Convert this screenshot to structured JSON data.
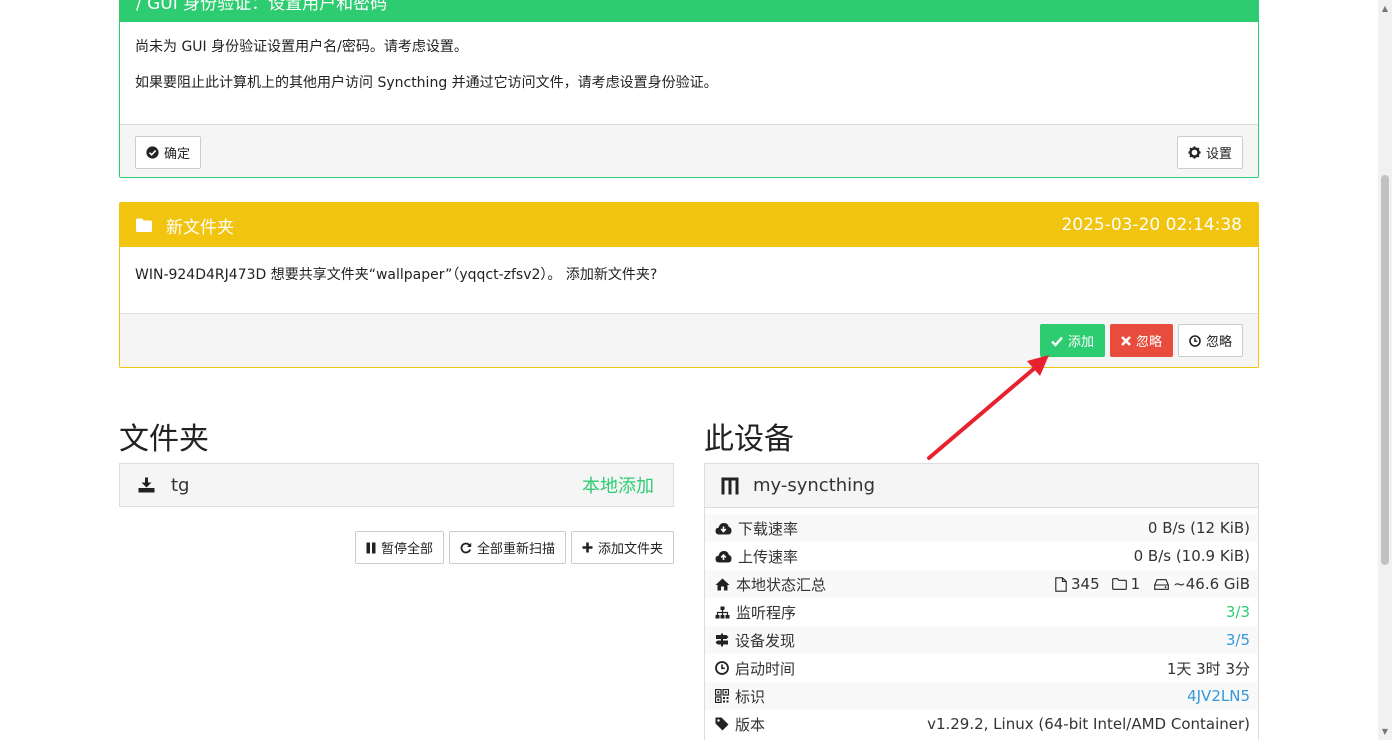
{
  "gui_notice": {
    "title": "/ GUI 身份验证：设置用户和密码",
    "line1": "尚未为 GUI 身份验证设置用户名/密码。请考虑设置。",
    "line2": "如果要阻止此计算机上的其他用户访问 Syncthing 并通过它访问文件，请考虑设置身份验证。",
    "ok_label": "确定",
    "settings_label": "设置"
  },
  "folder_notice": {
    "title": "新文件夹",
    "timestamp": "2025-03-20 02:14:38",
    "message": "WIN-924D4RJ473D 想要共享文件夹“wallpaper”（yqqct-zfsv2）。 添加新文件夹?",
    "add_label": "添加",
    "ignore_label": "忽略",
    "dismiss_label": "忽略"
  },
  "folders": {
    "heading": "文件夹",
    "items": [
      {
        "name": "tg",
        "status": "本地添加"
      }
    ],
    "pause_all_label": "暂停全部",
    "rescan_all_label": "全部重新扫描",
    "add_folder_label": "添加文件夹"
  },
  "device": {
    "heading": "此设备",
    "name": "my-syncthing",
    "rows": {
      "download": {
        "label": "下载速率",
        "value": "0 B/s (12 KiB)"
      },
      "upload": {
        "label": "上传速率",
        "value": "0 B/s (10.9 KiB)"
      },
      "local_state": {
        "label": "本地状态汇总",
        "files": "345",
        "dirs": "1",
        "size": "~46.6 GiB"
      },
      "listeners": {
        "label": "监听程序",
        "value": "3/3"
      },
      "discovery": {
        "label": "设备发现",
        "value": "3/5"
      },
      "uptime": {
        "label": "启动时间",
        "value": "1天 3时 3分"
      },
      "identity": {
        "label": "标识",
        "value": "4JV2LN5"
      },
      "version": {
        "label": "版本",
        "value": "v1.29.2, Linux (64-bit Intel/AMD Container)"
      }
    }
  },
  "colors": {
    "success": "#2ecc71",
    "warning": "#f1c40f",
    "danger": "#e74c3c",
    "info": "#3498db",
    "annotation_arrow": "#e8212e"
  }
}
